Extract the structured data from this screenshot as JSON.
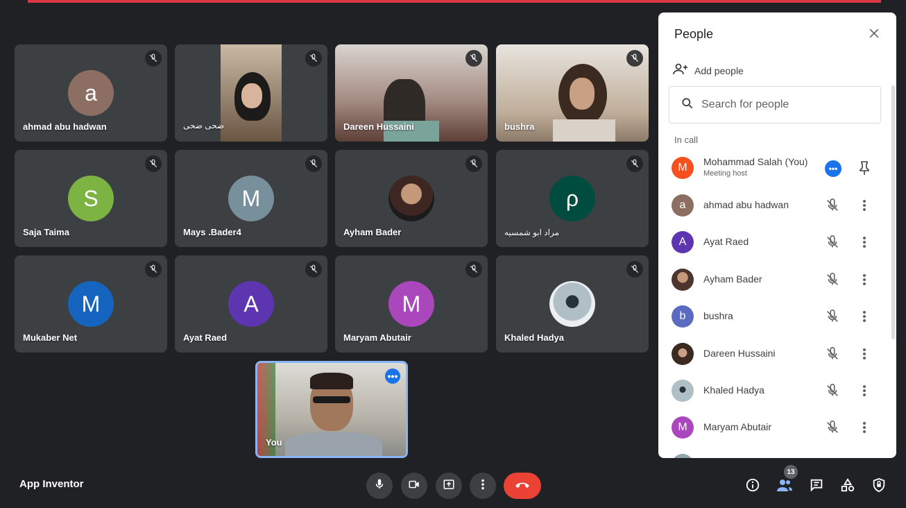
{
  "meeting": {
    "title": "App Inventor"
  },
  "tiles": [
    {
      "name": "ahmad abu hadwan",
      "initial": "a",
      "color": "#8d6e63",
      "type": "avatar"
    },
    {
      "name": "ضحى ضحى",
      "type": "video",
      "bg": "#6d5a48"
    },
    {
      "name": "Dareen Hussaini",
      "type": "video",
      "bg": "#7a6f65"
    },
    {
      "name": "bushra",
      "type": "video",
      "bg": "#9c8a78"
    },
    {
      "name": "Saja Taima",
      "initial": "S",
      "color": "#7cb342",
      "type": "avatar"
    },
    {
      "name": "Mays .Bader4",
      "initial": "M",
      "color": "#78909c",
      "type": "avatar"
    },
    {
      "name": "Ayham Bader",
      "type": "photo",
      "color": "#5d4037"
    },
    {
      "name": "مراد ابو شمسيه",
      "initial": "ρ",
      "color": "#004d40",
      "type": "avatar"
    },
    {
      "name": "Mukaber Net",
      "initial": "M",
      "color": "#1565c0",
      "type": "avatar"
    },
    {
      "name": "Ayat Raed",
      "initial": "A",
      "color": "#5e35b1",
      "type": "avatar"
    },
    {
      "name": "Maryam Abutair",
      "initial": "M",
      "color": "#ab47bc",
      "type": "avatar"
    },
    {
      "name": "Khaled Hadya",
      "type": "photo",
      "color": "#90a4ae"
    }
  ],
  "self_tile": {
    "name": "You",
    "more": "•••"
  },
  "people_panel": {
    "title": "People",
    "add_people": "Add people",
    "search_placeholder": "Search for people",
    "section": "In call",
    "people": [
      {
        "name": "Mohammad Salah (You)",
        "sub": "Meeting host",
        "initial": "M",
        "color": "#f4511e"
      },
      {
        "name": "ahmad abu hadwan",
        "initial": "a",
        "color": "#8d6e63"
      },
      {
        "name": "Ayat Raed",
        "initial": "A",
        "color": "#5e35b1"
      },
      {
        "name": "Ayham Bader",
        "initial": "",
        "color": "#6d4c41"
      },
      {
        "name": "bushra",
        "initial": "b",
        "color": "#5c6bc0"
      },
      {
        "name": "Dareen Hussaini",
        "initial": "",
        "color": "#8d6e63"
      },
      {
        "name": "Khaled Hadya",
        "initial": "",
        "color": "#90a4ae"
      },
      {
        "name": "Maryam Abutair",
        "initial": "M",
        "color": "#ab47bc"
      }
    ]
  },
  "controls": {
    "participant_count": "13"
  },
  "colors": {
    "accent": "#1a73e8",
    "end_call": "#ea4335",
    "self_border": "#8ab4f8"
  }
}
